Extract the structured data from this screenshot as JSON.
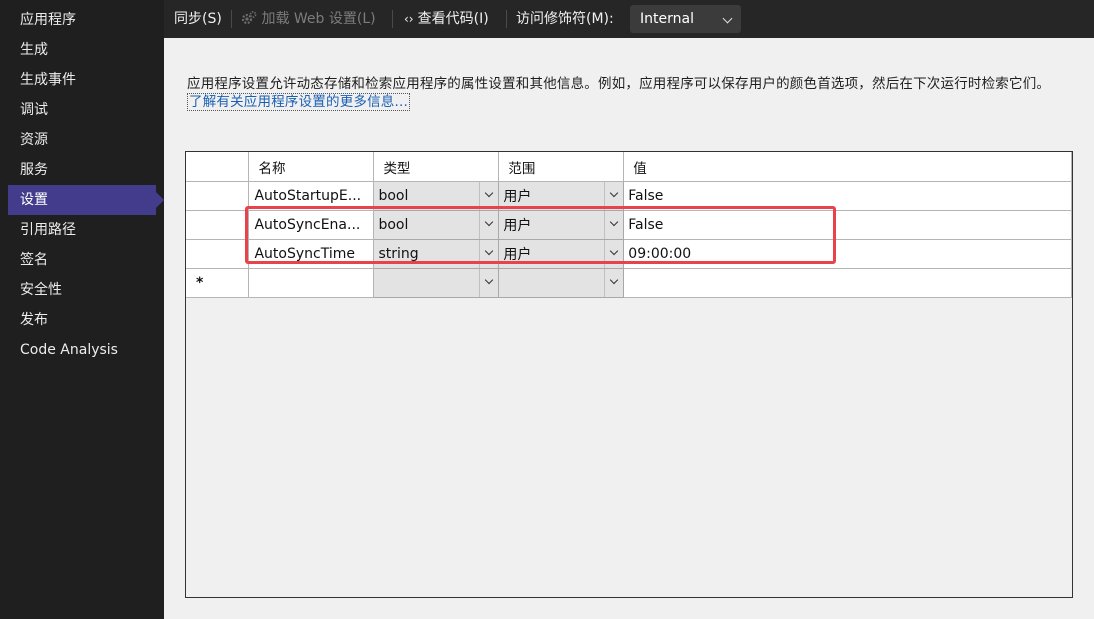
{
  "sidebar": {
    "items": [
      {
        "label": "应用程序"
      },
      {
        "label": "生成"
      },
      {
        "label": "生成事件"
      },
      {
        "label": "调试"
      },
      {
        "label": "资源"
      },
      {
        "label": "服务"
      },
      {
        "label": "设置",
        "active": true
      },
      {
        "label": "引用路径"
      },
      {
        "label": "签名"
      },
      {
        "label": "安全性"
      },
      {
        "label": "发布"
      },
      {
        "label": "Code Analysis"
      }
    ]
  },
  "toolbar": {
    "sync_label": "同步(S)",
    "load_web_label": "加载 Web 设置(L)",
    "view_code_label": "查看代码(I)",
    "access_modifier_label": "访问修饰符(M):",
    "access_modifier_value": "Internal"
  },
  "main": {
    "description": "应用程序设置允许动态存储和检索应用程序的属性设置和其他信息。例如，应用程序可以保存用户的颜色首选项，然后在下次运行时检索它们。",
    "learn_more_link": "了解有关应用程序设置的更多信息..."
  },
  "grid": {
    "columns": {
      "name": "名称",
      "type": "类型",
      "scope": "范围",
      "value": "值"
    },
    "rows": [
      {
        "name": "AutoStartupE...",
        "type": "bool",
        "scope": "用户",
        "value": "False"
      },
      {
        "name": "AutoSyncEna...",
        "type": "bool",
        "scope": "用户",
        "value": "False"
      },
      {
        "name": "AutoSyncTime",
        "type": "string",
        "scope": "用户",
        "value": "09:00:00"
      }
    ],
    "new_row_marker": "*"
  },
  "colors": {
    "accent": "#433c8c",
    "highlight": "#e8434b",
    "link": "#1a5fb4"
  }
}
